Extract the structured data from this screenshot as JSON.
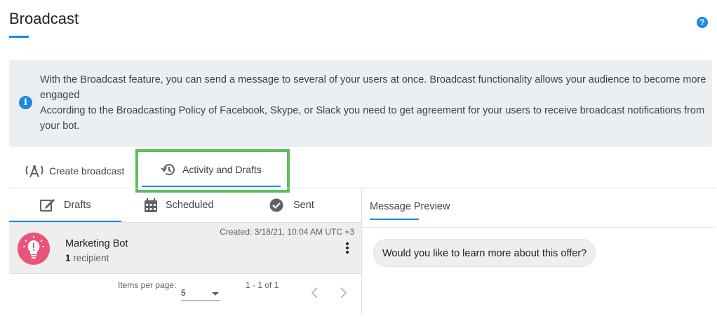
{
  "header": {
    "title": "Broadcast",
    "help_icon": "?"
  },
  "info": {
    "icon": "i",
    "line1": "With the Broadcast feature, you can send a message to several of your users at once. Broadcast functionality allows your audience to become more engaged",
    "line2": "According to the Broadcasting Policy of Facebook, Skype, or Slack you need to get agreement for your users to receive broadcast notifications from your bot."
  },
  "tabs": [
    {
      "label": "Create broadcast",
      "icon": "broadcast-antenna-icon"
    },
    {
      "label": "Activity and Drafts",
      "icon": "history-icon",
      "active": true
    }
  ],
  "subtabs": [
    {
      "label": "Drafts",
      "icon": "edit-icon",
      "active": true
    },
    {
      "label": "Scheduled",
      "icon": "calendar-icon"
    },
    {
      "label": "Sent",
      "icon": "check-circle-icon"
    }
  ],
  "drafts": [
    {
      "name": "Marketing Bot",
      "recipient_count": "1",
      "recipient_label": "recipient",
      "created": "Created: 3/18/21, 10:04 AM UTC +3"
    }
  ],
  "pagination": {
    "items_per_page_label": "Items per page:",
    "items_per_page": "5",
    "range": "1 - 1 of 1"
  },
  "preview": {
    "title": "Message Preview",
    "message": "Would you like to learn more about this offer?"
  },
  "colors": {
    "accent": "#1e88e5",
    "highlight": "#5cbf5c",
    "avatar": "#e9557a",
    "info_bg": "#eceff1"
  }
}
